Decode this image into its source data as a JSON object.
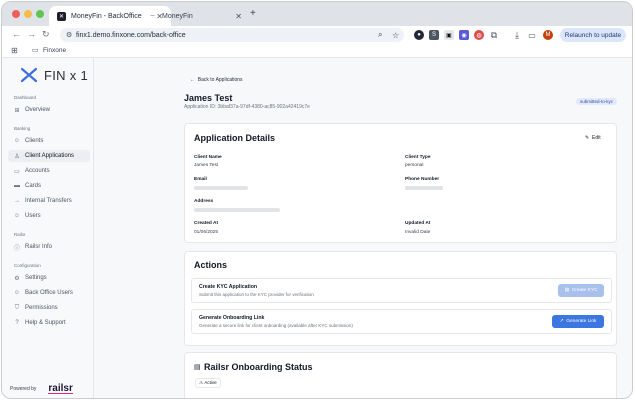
{
  "browser": {
    "tabs": [
      {
        "title": "MoneyFin - BackOffice"
      },
      {
        "title": "MoneyFin"
      }
    ],
    "url": "finx1.demo.finxone.com/back-office",
    "relaunch_label": "Relaunch to update",
    "bookmark_folder": "Finxone",
    "profile_initial": "M"
  },
  "sidebar": {
    "logo_text": "FIN x 1",
    "sections": [
      {
        "title": "Dashboard",
        "items": [
          {
            "label": "Overview",
            "icon": "grid-icon"
          }
        ]
      },
      {
        "title": "Banking",
        "items": [
          {
            "label": "Clients",
            "icon": "users-icon"
          },
          {
            "label": "Client Applications",
            "icon": "user-check-icon",
            "active": true
          },
          {
            "label": "Accounts",
            "icon": "wallet-icon"
          },
          {
            "label": "Cards",
            "icon": "card-icon"
          },
          {
            "label": "Internal Transfers",
            "icon": "arrows-icon"
          },
          {
            "label": "Users",
            "icon": "user-icon"
          }
        ]
      },
      {
        "title": "Railsr",
        "items": [
          {
            "label": "Railsr Info",
            "icon": "info-icon"
          }
        ]
      },
      {
        "title": "Configuration",
        "items": [
          {
            "label": "Settings",
            "icon": "gear-icon"
          },
          {
            "label": "Back Office Users",
            "icon": "users-icon"
          },
          {
            "label": "Permissions",
            "icon": "shield-icon"
          },
          {
            "label": "Help & Support",
            "icon": "help-icon"
          }
        ]
      }
    ],
    "powered_by": "Powered by",
    "powered_brand": "railsr"
  },
  "page": {
    "back_label": "Back to Applications",
    "title": "James Test",
    "application_id": "Application ID: 3bbaf37a-97df-4380-ac85-902a42419c7e",
    "status": "submitted-to-kyc"
  },
  "details": {
    "heading": "Application Details",
    "edit_label": "Edit",
    "client_name_label": "Client Name",
    "client_name": "James Test",
    "client_type_label": "Client Type",
    "client_type": "personal",
    "email_label": "Email",
    "phone_label": "Phone Number",
    "address_label": "Address",
    "created_label": "Created At",
    "created_at": "01/06/2025",
    "updated_label": "Updated At",
    "updated_at": "Invalid Date"
  },
  "actions": {
    "heading": "Actions",
    "items": [
      {
        "title": "Create KYC Application",
        "description": "Submit this application to the KYC provider for verification",
        "button": "Create KYC"
      },
      {
        "title": "Generate Onboarding Link",
        "description": "Generate a secure link for client onboarding (available after KYC submission)",
        "button": "Generate Link"
      }
    ]
  },
  "railsr_status": {
    "heading": "Railsr Onboarding Status",
    "badge": "Active"
  }
}
